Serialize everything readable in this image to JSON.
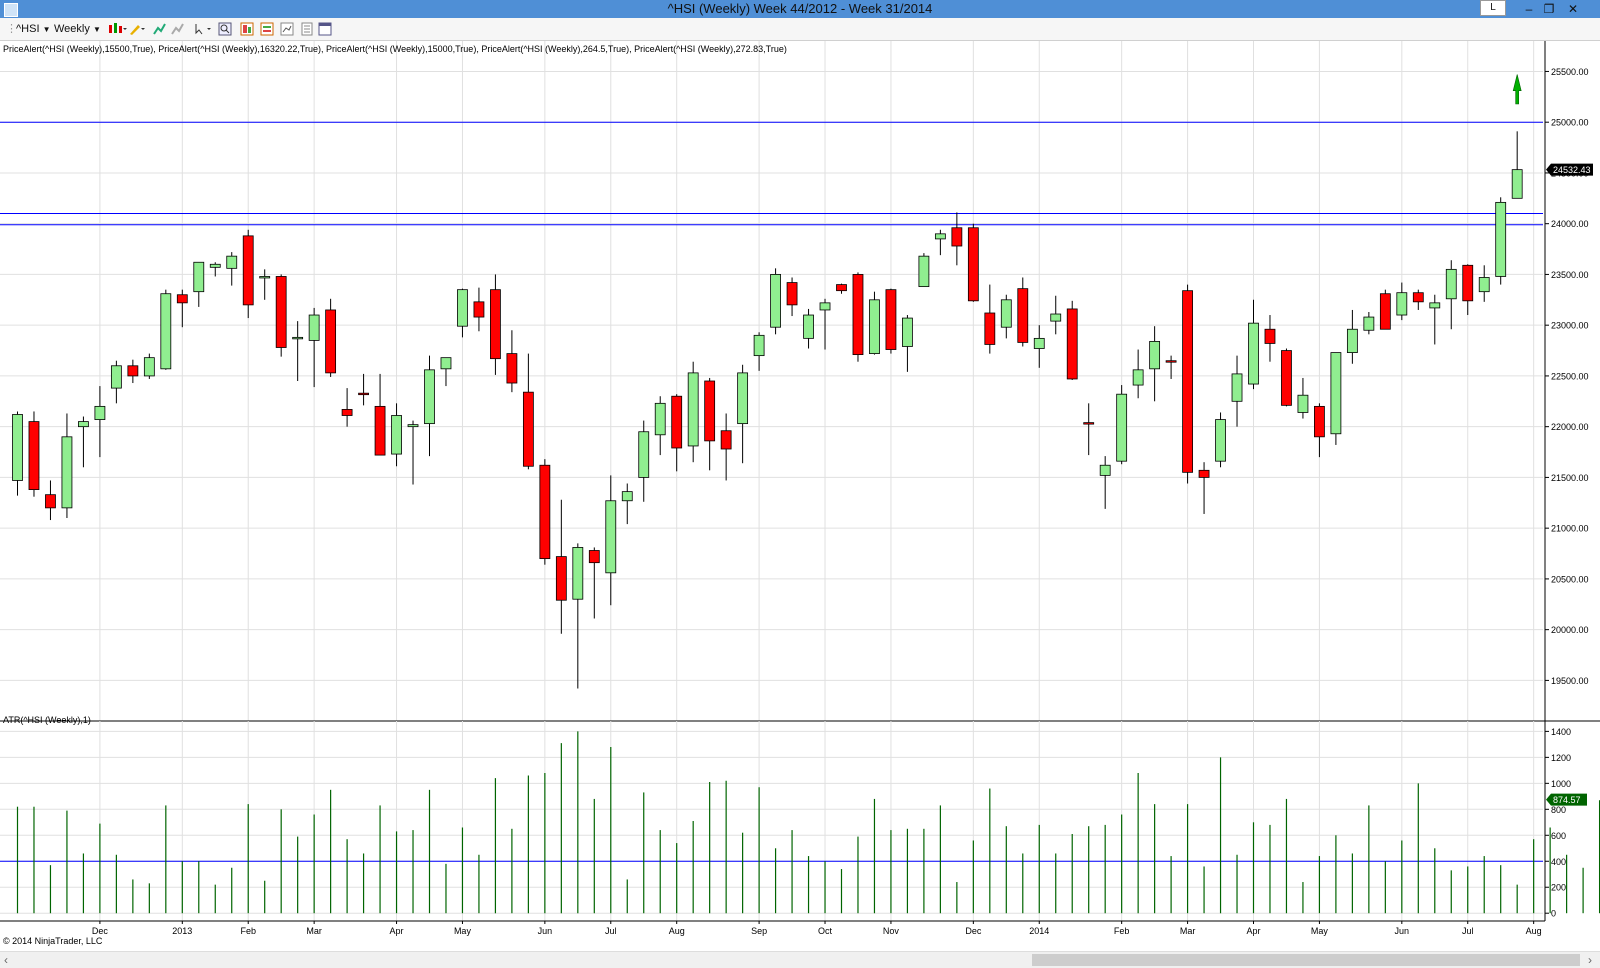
{
  "window": {
    "title": "^HSI (Weekly)  Week 44/2012 - Week 31/2014",
    "controls": {
      "l_label": "L",
      "minimize": "–",
      "restore": "❐",
      "close": "✕"
    }
  },
  "toolbar": {
    "instrument": "^HSI",
    "period": "Weekly",
    "icons": [
      "bar-type-icon",
      "pencil-draw-icon",
      "indicator-icon",
      "strategy-icon",
      "zoom-icon",
      "magnifier-icon",
      "data-box-icon",
      "chart-trader-icon",
      "template-icon",
      "properties-icon",
      "window-icon"
    ]
  },
  "indicator_labels": {
    "price_alerts": "PriceAlert(^HSI (Weekly),15500,True), PriceAlert(^HSI (Weekly),16320.22,True), PriceAlert(^HSI (Weekly),15000,True), PriceAlert(^HSI (Weekly),264.5,True), PriceAlert(^HSI (Weekly),272.83,True)",
    "atr": "ATR(^HSI (Weekly),1)"
  },
  "copyright": "© 2014 NinjaTrader, LLC",
  "colors": {
    "up": "#90ee90",
    "down": "#ff0000",
    "atr": "#006400",
    "alert_line": "#0000ff",
    "grid": "#e0e0e0"
  },
  "chart_data": [
    {
      "type": "candlestick",
      "title": "",
      "ylim": [
        19100,
        25800
      ],
      "y_ticks": [
        "25500.00",
        "25000.00",
        "24500.00",
        "24000.00",
        "23500.00",
        "23000.00",
        "22500.00",
        "22000.00",
        "21500.00",
        "21000.00",
        "20500.00",
        "20000.00",
        "19500.00"
      ],
      "y_tick_values": [
        25500,
        25000,
        24500,
        24000,
        23500,
        23000,
        22500,
        22000,
        21500,
        21000,
        20500,
        20000,
        19500
      ],
      "x_tick_labels": [
        {
          "label": "Dec",
          "bar": 5
        },
        {
          "label": "2013",
          "bar": 10
        },
        {
          "label": "Feb",
          "bar": 14
        },
        {
          "label": "Mar",
          "bar": 18
        },
        {
          "label": "Apr",
          "bar": 23
        },
        {
          "label": "May",
          "bar": 27
        },
        {
          "label": "Jun",
          "bar": 32
        },
        {
          "label": "Jul",
          "bar": 36
        },
        {
          "label": "Aug",
          "bar": 40
        },
        {
          "label": "Sep",
          "bar": 45
        },
        {
          "label": "Oct",
          "bar": 49
        },
        {
          "label": "Nov",
          "bar": 53
        },
        {
          "label": "Dec",
          "bar": 58
        },
        {
          "label": "2014",
          "bar": 62
        },
        {
          "label": "Feb",
          "bar": 67
        },
        {
          "label": "Mar",
          "bar": 71
        },
        {
          "label": "Apr",
          "bar": 75
        },
        {
          "label": "May",
          "bar": 79
        },
        {
          "label": "Jun",
          "bar": 84
        },
        {
          "label": "Jul",
          "bar": 88
        },
        {
          "label": "Aug",
          "bar": 92
        }
      ],
      "alert_lines": [
        25000,
        24100,
        23990
      ],
      "last_price_label": "24532.43",
      "last_price": 24532.43,
      "ohlc": [
        [
          21470,
          22150,
          21320,
          22120
        ],
        [
          22050,
          22150,
          21310,
          21380
        ],
        [
          21330,
          21470,
          21080,
          21200
        ],
        [
          21200,
          22130,
          21100,
          21900
        ],
        [
          22000,
          22100,
          21600,
          22050
        ],
        [
          22070,
          22400,
          21700,
          22200
        ],
        [
          22380,
          22650,
          22230,
          22600
        ],
        [
          22600,
          22660,
          22430,
          22500
        ],
        [
          22500,
          22720,
          22470,
          22680
        ],
        [
          22570,
          23350,
          22560,
          23310
        ],
        [
          23300,
          23350,
          22980,
          23220
        ],
        [
          23330,
          23600,
          23180,
          23620
        ],
        [
          23570,
          23620,
          23480,
          23600
        ],
        [
          23560,
          23720,
          23390,
          23680
        ],
        [
          23880,
          23940,
          23070,
          23200
        ],
        [
          23470,
          23550,
          23250,
          23480
        ],
        [
          23480,
          23500,
          22690,
          22780
        ],
        [
          22870,
          23040,
          22450,
          22880
        ],
        [
          22850,
          23170,
          22390,
          23100
        ],
        [
          23150,
          23260,
          22490,
          22530
        ],
        [
          22170,
          22380,
          22000,
          22110
        ],
        [
          22330,
          22520,
          22210,
          22320
        ],
        [
          22200,
          22520,
          21720,
          21720
        ],
        [
          21730,
          22230,
          21610,
          22110
        ],
        [
          22000,
          22060,
          21430,
          22020
        ],
        [
          22030,
          22700,
          21710,
          22560
        ],
        [
          22570,
          22680,
          22400,
          22680
        ],
        [
          22990,
          23360,
          22880,
          23350
        ],
        [
          23230,
          23370,
          22940,
          23080
        ],
        [
          23350,
          23500,
          22510,
          22670
        ],
        [
          22720,
          22950,
          22340,
          22430
        ],
        [
          22340,
          22720,
          21580,
          21610
        ],
        [
          21620,
          21680,
          20640,
          20700
        ],
        [
          20720,
          21280,
          19960,
          20290
        ],
        [
          20300,
          20850,
          19420,
          20810
        ],
        [
          20780,
          20810,
          20110,
          20660
        ],
        [
          20560,
          21520,
          20240,
          21270
        ],
        [
          21270,
          21440,
          21040,
          21360
        ],
        [
          21500,
          22060,
          21260,
          21950
        ],
        [
          21920,
          22300,
          21720,
          22230
        ],
        [
          22300,
          22320,
          21560,
          21790
        ],
        [
          21810,
          22640,
          21650,
          22530
        ],
        [
          22450,
          22480,
          21570,
          21860
        ],
        [
          21960,
          22130,
          21470,
          21780
        ],
        [
          22030,
          22610,
          21640,
          22530
        ],
        [
          22700,
          22930,
          22550,
          22900
        ],
        [
          22980,
          23560,
          22910,
          23500
        ],
        [
          23420,
          23470,
          23090,
          23200
        ],
        [
          22870,
          23160,
          22770,
          23100
        ],
        [
          23150,
          23260,
          22760,
          23220
        ],
        [
          23400,
          23410,
          23310,
          23340
        ],
        [
          23500,
          23520,
          22640,
          22710
        ],
        [
          22720,
          23330,
          22710,
          23250
        ],
        [
          23350,
          23360,
          22720,
          22760
        ],
        [
          22790,
          23100,
          22540,
          23070
        ],
        [
          23380,
          23710,
          23380,
          23680
        ],
        [
          23850,
          23940,
          23690,
          23900
        ],
        [
          23960,
          24111,
          23590,
          23780
        ],
        [
          23960,
          24000,
          23230,
          23240
        ],
        [
          23120,
          23400,
          22720,
          22810
        ],
        [
          22980,
          23300,
          22870,
          23250
        ],
        [
          23360,
          23470,
          22790,
          22830
        ],
        [
          22770,
          23000,
          22580,
          22870
        ],
        [
          23040,
          23290,
          22910,
          23110
        ],
        [
          23160,
          23240,
          22460,
          22470
        ],
        [
          22040,
          22230,
          21720,
          22030
        ],
        [
          21520,
          21710,
          21190,
          21620
        ],
        [
          21660,
          22410,
          21630,
          22320
        ],
        [
          22410,
          22760,
          22280,
          22560
        ],
        [
          22570,
          22990,
          22250,
          22840
        ],
        [
          22650,
          22700,
          22470,
          22640
        ],
        [
          23340,
          23400,
          21440,
          21550
        ],
        [
          21570,
          21650,
          21140,
          21500
        ],
        [
          21660,
          22140,
          21600,
          22070
        ],
        [
          22250,
          22700,
          22000,
          22520
        ],
        [
          22420,
          23250,
          22370,
          23020
        ],
        [
          22960,
          23100,
          22640,
          22820
        ],
        [
          22750,
          22770,
          22200,
          22210
        ],
        [
          22140,
          22480,
          22080,
          22310
        ],
        [
          22200,
          22230,
          21700,
          21900
        ],
        [
          21930,
          22730,
          21820,
          22730
        ],
        [
          22730,
          23150,
          22620,
          22960
        ],
        [
          22950,
          23130,
          22910,
          23080
        ],
        [
          23310,
          23350,
          22960,
          22960
        ],
        [
          23100,
          23420,
          23050,
          23320
        ],
        [
          23320,
          23350,
          23150,
          23230
        ],
        [
          23170,
          23300,
          22810,
          23220
        ],
        [
          23260,
          23640,
          22960,
          23550
        ],
        [
          23590,
          23600,
          23100,
          23240
        ],
        [
          23330,
          23590,
          23230,
          23470
        ],
        [
          23480,
          24260,
          23400,
          24210
        ],
        [
          24250,
          24910,
          24250,
          24532.43
        ]
      ]
    },
    {
      "type": "bar",
      "title": "",
      "ylim": [
        -60,
        1480
      ],
      "y_ticks": [
        "1400",
        "1200",
        "1000",
        "800",
        "600",
        "400",
        "200",
        "0"
      ],
      "y_tick_values": [
        1400,
        1200,
        1000,
        800,
        600,
        400,
        200,
        0
      ],
      "alert_lines": [
        400
      ],
      "last_value_label": "874.57",
      "last_value": 874.57,
      "values": [
        820,
        820,
        370,
        790,
        460,
        690,
        450,
        260,
        230,
        830,
        400,
        400,
        220,
        350,
        840,
        250,
        800,
        590,
        760,
        950,
        570,
        460,
        830,
        630,
        640,
        950,
        380,
        660,
        450,
        1040,
        650,
        1060,
        1080,
        1310,
        1400,
        880,
        1280,
        260,
        930,
        640,
        540,
        710,
        1010,
        1020,
        620,
        970,
        500,
        640,
        440,
        400,
        340,
        590,
        880,
        640,
        650,
        650,
        830,
        240,
        560,
        960,
        670,
        460,
        680,
        460,
        610,
        670,
        680,
        760,
        1080,
        840,
        440,
        840,
        360,
        1200,
        450,
        700,
        680,
        880,
        240,
        440,
        600,
        460,
        830,
        400,
        560,
        1000,
        500,
        330,
        360,
        440,
        370,
        220,
        570,
        660,
        450,
        350,
        870
      ]
    }
  ]
}
